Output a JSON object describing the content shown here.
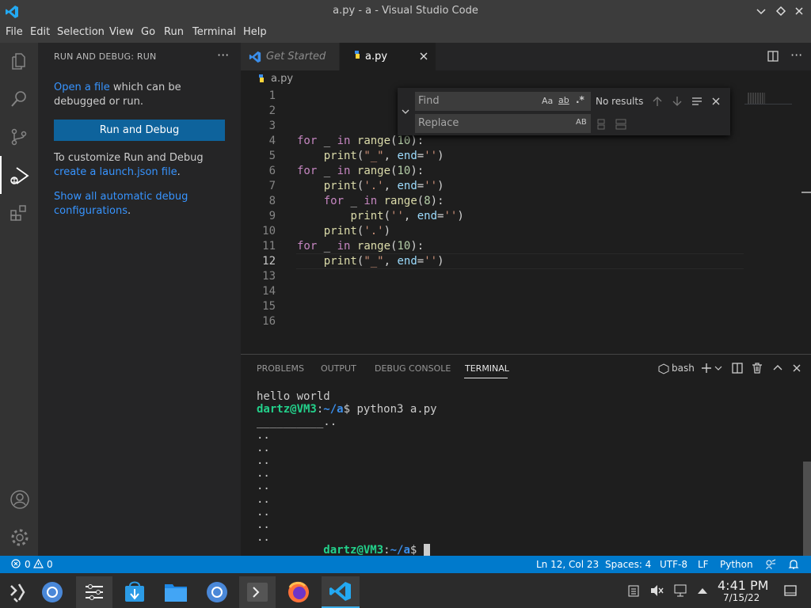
{
  "window": {
    "title": "a.py - a - Visual Studio Code"
  },
  "menu": [
    "File",
    "Edit",
    "Selection",
    "View",
    "Go",
    "Run",
    "Terminal",
    "Help"
  ],
  "sidebar": {
    "header": "RUN AND DEBUG: RUN",
    "more": "···",
    "open_link": "Open a file",
    "open_rest": " which can be debugged or run.",
    "run_button": "Run and Debug",
    "customize_text": "To customize Run and Debug",
    "launch_link": "create a launch.json file",
    "launch_end": ".",
    "show_link": "Show all automatic debug configurations",
    "show_end": "."
  },
  "tabs": [
    {
      "label": "Get Started"
    },
    {
      "label": "a.py"
    }
  ],
  "breadcrumb": "a.py",
  "editor": {
    "line_numbers": [
      "1",
      "2",
      "3",
      "4",
      "5",
      "6",
      "7",
      "8",
      "9",
      "10",
      "11",
      "12",
      "13",
      "14",
      "15",
      "16"
    ],
    "code": {
      "l4": {
        "kw": "for",
        "mid": " _ ",
        "in": "in",
        "fn": "range",
        "open": "(",
        "num": "10",
        "close": "):"
      },
      "l5": {
        "indent": "    ",
        "fn": "print",
        "open": "(",
        "str": "\"_\"",
        "comma": ", ",
        "var": "end",
        "eq": "=",
        "str2": "''",
        "close": ")"
      },
      "l6": {
        "kw": "for",
        "mid": " _ ",
        "in": "in",
        "fn": "range",
        "open": "(",
        "num": "10",
        "close": "):"
      },
      "l7": {
        "indent": "    ",
        "fn": "print",
        "open": "(",
        "str": "'.'",
        "comma": ", ",
        "var": "end",
        "eq": "=",
        "str2": "''",
        "close": ")"
      },
      "l8": {
        "indent": "    ",
        "kw": "for",
        "mid": " _ ",
        "in": "in",
        "fn": "range",
        "open": "(",
        "num": "8",
        "close": "):"
      },
      "l9": {
        "indent": "        ",
        "fn": "print",
        "open": "(",
        "str": "''",
        "comma": ", ",
        "var": "end",
        "eq": "=",
        "str2": "''",
        "close": ")"
      },
      "l10": {
        "indent": "    ",
        "fn": "print",
        "open": "(",
        "str": "'.'",
        "close": ")"
      },
      "l11": {
        "kw": "for",
        "mid": " _ ",
        "in": "in",
        "fn": "range",
        "open": "(",
        "num": "10",
        "close": "):"
      },
      "l12": {
        "indent": "    ",
        "fn": "print",
        "open": "(",
        "str": "\"_\"",
        "comma": ", ",
        "var": "end",
        "eq": "=",
        "str2": "''",
        "close": ")"
      }
    }
  },
  "find_widget": {
    "find_placeholder": "Find",
    "replace_placeholder": "Replace",
    "match_case": "Aa",
    "whole_word": "ab",
    "regex": ".*",
    "preserve_case": "AB",
    "result": "No results"
  },
  "panel": {
    "tabs": [
      "PROBLEMS",
      "OUTPUT",
      "DEBUG CONSOLE",
      "TERMINAL"
    ],
    "shell": "bash",
    "terminal": {
      "line1": "hello world",
      "user": "dartz@VM3",
      "colon": ":",
      "path": "~/a",
      "prompt_end": "$ ",
      "command": "python3 a.py",
      "output": [
        "__________..",
        "..",
        "..",
        "..",
        "..",
        "..",
        "..",
        "..",
        "..",
        ".."
      ],
      "last_prefix": "__________"
    }
  },
  "status": {
    "errors": "0",
    "warnings": "0",
    "position": "Ln 12, Col 23",
    "spaces": "Spaces: 4",
    "encoding": "UTF-8",
    "eol": "LF",
    "language": "Python"
  },
  "taskbar": {
    "time": "4:41 PM",
    "date": "7/15/22"
  },
  "colors": {
    "accent": "#007acc",
    "button": "#0e639c",
    "link": "#3794ff"
  }
}
